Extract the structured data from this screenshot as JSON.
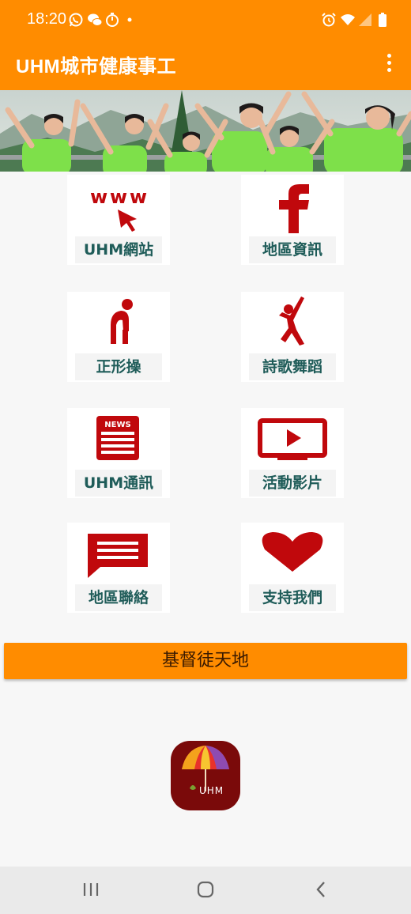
{
  "status_bar": {
    "time": "18:20",
    "left_icons": [
      "whatsapp-icon",
      "wechat-icon",
      "timer-icon",
      "dot-icon"
    ],
    "right_icons": [
      "alarm-icon",
      "wifi-icon",
      "signal-icon",
      "battery-icon"
    ]
  },
  "app_bar": {
    "title": "UHM城市健康事工",
    "menu_icon": "more-vert-icon",
    "color": "#ff8c00"
  },
  "banner": {
    "image": "group-exercise-photo"
  },
  "grid": [
    {
      "label": "UHM網站",
      "icon": "www-cursor-icon"
    },
    {
      "label": "地區資訊",
      "icon": "facebook-icon"
    },
    {
      "label": "正形操",
      "icon": "stretching-figure-icon"
    },
    {
      "label": "詩歌舞蹈",
      "icon": "dancing-figure-icon"
    },
    {
      "label": "UHM通訊",
      "icon": "news-icon",
      "icon_text": "NEWS"
    },
    {
      "label": "活動影片",
      "icon": "video-play-icon"
    },
    {
      "label": "地區聯絡",
      "icon": "message-icon"
    },
    {
      "label": "支持我們",
      "icon": "heart-icon"
    }
  ],
  "icon_color": "#c0080c",
  "main_button": {
    "label": "基督徒天地"
  },
  "logo": {
    "text": "UHM",
    "icon": "umbrella-logo-icon"
  },
  "nav_bar": {
    "icons": [
      "recents-icon",
      "home-icon",
      "back-icon"
    ]
  }
}
